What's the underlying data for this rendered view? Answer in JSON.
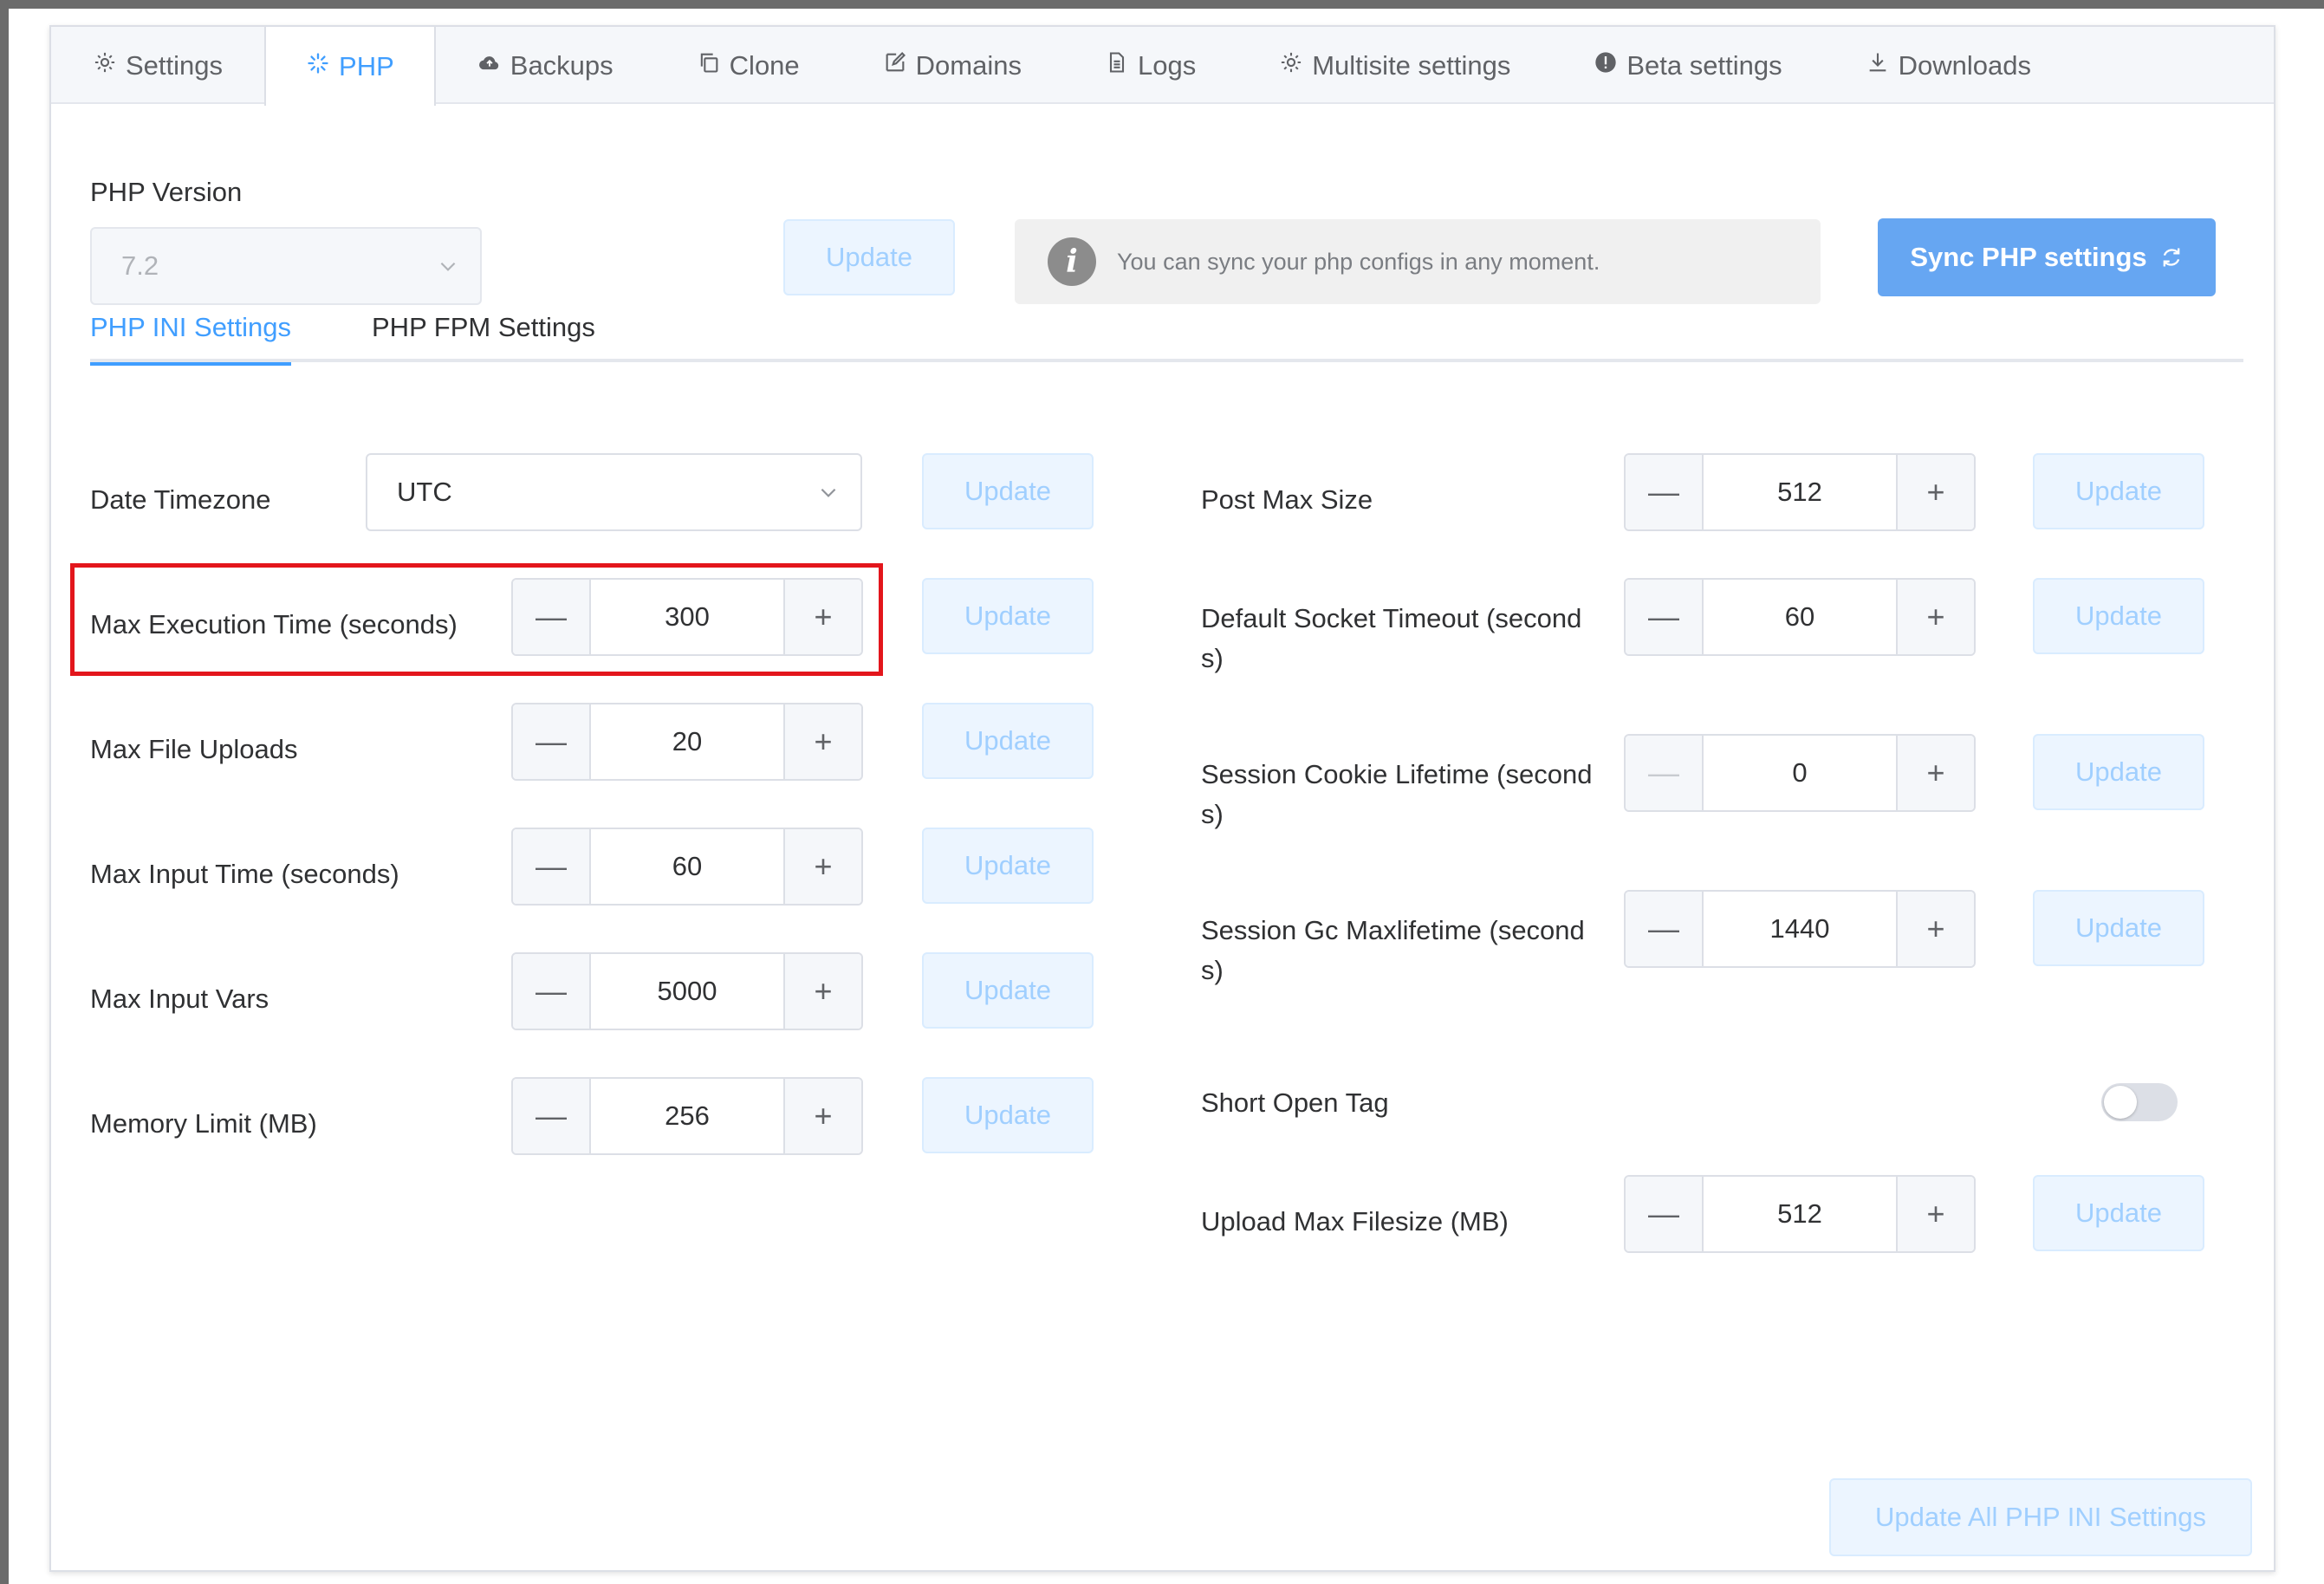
{
  "tabs": [
    {
      "label": "Settings",
      "icon": "gear-icon"
    },
    {
      "label": "PHP",
      "icon": "spinner-icon"
    },
    {
      "label": "Backups",
      "icon": "cloud-upload-icon"
    },
    {
      "label": "Clone",
      "icon": "copy-icon"
    },
    {
      "label": "Domains",
      "icon": "edit-icon"
    },
    {
      "label": "Logs",
      "icon": "document-icon"
    },
    {
      "label": "Multisite settings",
      "icon": "gear-icon"
    },
    {
      "label": "Beta settings",
      "icon": "warning-icon"
    },
    {
      "label": "Downloads",
      "icon": "download-icon"
    }
  ],
  "active_tab": "PHP",
  "php_version": {
    "label": "PHP Version",
    "value": "7.2",
    "update_label": "Update"
  },
  "info": {
    "text": "You can sync your php configs in any moment."
  },
  "sync_button": {
    "label": "Sync PHP settings"
  },
  "subtabs": [
    "PHP INI Settings",
    "PHP FPM Settings"
  ],
  "left_settings": {
    "timezone": {
      "label": "Date Timezone",
      "value": "UTC",
      "update": "Update"
    },
    "max_execution_time": {
      "label": "Max Execution Time (seconds)",
      "value": "300",
      "update": "Update"
    },
    "max_file_uploads": {
      "label": "Max File Uploads",
      "value": "20",
      "update": "Update"
    },
    "max_input_time": {
      "label": "Max Input Time (seconds)",
      "value": "60",
      "update": "Update"
    },
    "max_input_vars": {
      "label": "Max Input Vars",
      "value": "5000",
      "update": "Update"
    },
    "memory_limit": {
      "label": "Memory Limit (MB)",
      "value": "256",
      "update": "Update"
    }
  },
  "right_settings": {
    "post_max_size": {
      "label": "Post Max Size",
      "value": "512",
      "update": "Update"
    },
    "default_socket_timeout": {
      "label_line1": "Default Socket Timeout (second",
      "label_line2": "s)",
      "value": "60",
      "update": "Update"
    },
    "session_cookie_lifetime": {
      "label_line1": "Session Cookie Lifetime (second",
      "label_line2": "s)",
      "value": "0",
      "update": "Update"
    },
    "session_gc_maxlifetime": {
      "label_line1": "Session Gc Maxlifetime (second",
      "label_line2": "s)",
      "value": "1440",
      "update": "Update"
    },
    "short_open_tag": {
      "label": "Short Open Tag",
      "enabled": false
    },
    "upload_max_filesize": {
      "label": "Upload Max Filesize (MB)",
      "value": "512",
      "update": "Update"
    }
  },
  "stepper_symbols": {
    "minus": "—",
    "plus": "+"
  },
  "update_all_label": "Update All PHP INI Settings",
  "colors": {
    "accent": "#409eff",
    "primary_button": "#66a6f2",
    "highlight": "#e3161c"
  }
}
